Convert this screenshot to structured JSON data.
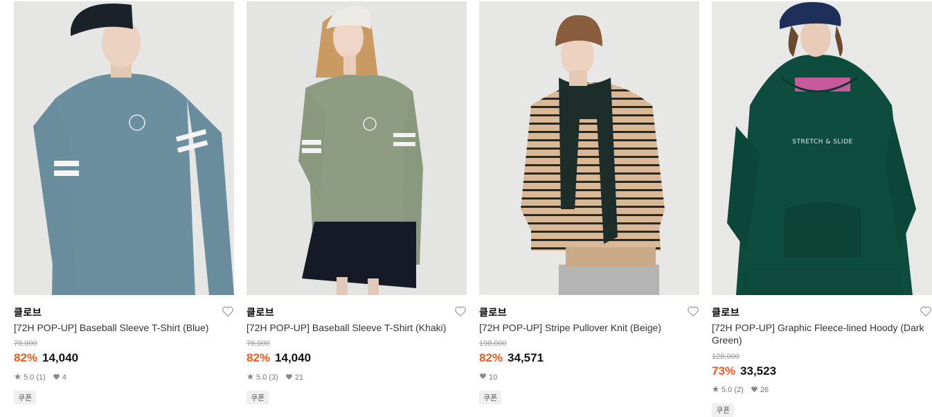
{
  "products": [
    {
      "brand": "클로브",
      "title": "[72H POP-UP] Baseball Sleeve T-Shirt (Blue)",
      "original_price": "78,000",
      "discount": "82%",
      "price": "14,040",
      "rating": "5.0",
      "reviews": "(1)",
      "likes": "4",
      "badge": "쿠폰",
      "image_label": "model wearing blue long sleeve t-shirt with striped sleeve"
    },
    {
      "brand": "클로브",
      "title": "[72H POP-UP] Baseball Sleeve T-Shirt (Khaki)",
      "original_price": "78,000",
      "discount": "82%",
      "price": "14,040",
      "rating": "5.0",
      "reviews": "(3)",
      "likes": "21",
      "badge": "쿠폰",
      "image_label": "model wearing khaki long sleeve t-shirt and navy skirt"
    },
    {
      "brand": "클로브",
      "title": "[72H POP-UP] Stripe Pullover Knit (Beige)",
      "original_price": "198,000",
      "discount": "82%",
      "price": "34,571",
      "likes": "10",
      "badge": "쿠폰",
      "image_label": "model wearing beige striped knit and dark scarf"
    },
    {
      "brand": "클로브",
      "title": "[72H POP-UP] Graphic Fleece-lined Hoody (Dark Green)",
      "original_price": "128,000",
      "discount": "73%",
      "price": "33,523",
      "rating": "5.0",
      "reviews": "(2)",
      "likes": "26",
      "badge": "쿠폰",
      "image_label": "model wearing dark green hoodie",
      "print_text": "STRETCH & SLIDE"
    }
  ],
  "colors": {
    "discount": "#ef5a1e",
    "muted": "#9a9a9a",
    "icon": "#8a8a8a"
  },
  "icons": {
    "wishlist": "heart-outline-icon",
    "rating": "star-icon",
    "likes": "heart-filled-icon"
  }
}
